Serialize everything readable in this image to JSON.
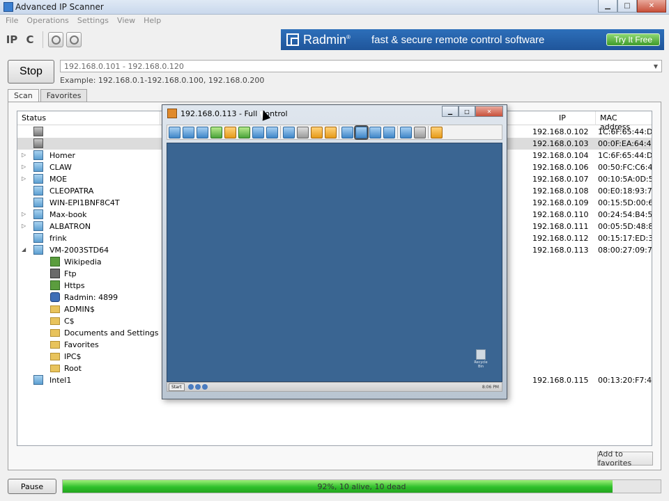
{
  "window": {
    "title": "Advanced IP Scanner",
    "controls": [
      "minimize-icon",
      "maximize-icon",
      "close-icon"
    ]
  },
  "menu": [
    "File",
    "Operations",
    "Settings",
    "View",
    "Help"
  ],
  "toolbar": {
    "ip_label": "IP",
    "c_label": "C",
    "icons": [
      "power-icon",
      "power-icon"
    ]
  },
  "ad": {
    "brand": "Radmin",
    "registered": "®",
    "slogan": "fast & secure remote control software",
    "cta": "Try It Free",
    "color": "#2a66b0"
  },
  "scan": {
    "stop_label": "Stop",
    "range_value": "192.168.0.101 - 192.168.0.120",
    "example": "Example: 192.168.0.1-192.168.0.100, 192.168.0.200"
  },
  "tabs": [
    "Scan",
    "Favorites"
  ],
  "columns": {
    "status": "Status",
    "ip": "IP",
    "mac": "MAC address"
  },
  "rows": [
    {
      "name": "",
      "ip": "192.168.0.102",
      "mac": "1C:6F:65:44:D...",
      "icon": "computer-icon",
      "expander": "",
      "selected": false
    },
    {
      "name": "",
      "ip": "192.168.0.103",
      "mac": "00:0F:EA:64:4...",
      "icon": "computer-icon",
      "expander": "",
      "selected": true
    },
    {
      "name": "Homer",
      "ip": "192.168.0.104",
      "mac": "1C:6F:65:44:D...",
      "icon": "computer-icon",
      "expander": "▷",
      "selected": false
    },
    {
      "name": "CLAW",
      "ip": "192.168.0.106",
      "mac": "00:50:FC:C6:4...",
      "icon": "computer-icon",
      "expander": "▷",
      "selected": false
    },
    {
      "name": "MOE",
      "ip": "192.168.0.107",
      "mac": "00:10:5A:0D:5...",
      "icon": "computer-icon",
      "expander": "▷",
      "selected": false
    },
    {
      "name": "CLEOPATRA",
      "ip": "192.168.0.108",
      "mac": "00:E0:18:93:7...",
      "icon": "computer-icon",
      "expander": "",
      "selected": false
    },
    {
      "name": "WIN-EPI1BNF8C4T",
      "ip": "192.168.0.109",
      "mac": "00:15:5D:00:6...",
      "icon": "computer-icon",
      "expander": "",
      "selected": false
    },
    {
      "name": "Max-book",
      "ip": "192.168.0.110",
      "mac": "00:24:54:B4:5...",
      "icon": "computer-icon",
      "expander": "▷",
      "selected": false
    },
    {
      "name": "ALBATRON",
      "ip": "192.168.0.111",
      "mac": "00:05:5D:48:8...",
      "icon": "computer-icon",
      "expander": "▷",
      "selected": false
    },
    {
      "name": "frink",
      "ip": "192.168.0.112",
      "mac": "00:15:17:ED:3...",
      "icon": "computer-icon",
      "expander": "",
      "selected": false
    },
    {
      "name": "VM-2003STD64",
      "ip": "192.168.0.113",
      "mac": "08:00:27:09:7...",
      "icon": "computer-icon",
      "expander": "◢",
      "selected": false
    },
    {
      "name": "Wikipedia",
      "ip": "",
      "mac": "",
      "icon": "http-service-icon",
      "expander": "",
      "child": true
    },
    {
      "name": "Ftp",
      "ip": "",
      "mac": "",
      "icon": "ftp-icon",
      "expander": "",
      "child": true
    },
    {
      "name": "Https",
      "ip": "",
      "mac": "",
      "icon": "https-service-icon",
      "expander": "",
      "child": true
    },
    {
      "name": "Radmin: 4899",
      "ip": "",
      "mac": "",
      "icon": "radmin-icon",
      "expander": "",
      "child": true
    },
    {
      "name": "ADMIN$",
      "ip": "",
      "mac": "",
      "icon": "folder-icon",
      "expander": "",
      "child": true
    },
    {
      "name": "C$",
      "ip": "",
      "mac": "",
      "icon": "folder-icon",
      "expander": "",
      "child": true
    },
    {
      "name": "Documents and Settings",
      "ip": "",
      "mac": "",
      "icon": "folder-icon",
      "expander": "",
      "child": true
    },
    {
      "name": "Favorites",
      "ip": "",
      "mac": "",
      "icon": "folder-icon",
      "expander": "",
      "child": true
    },
    {
      "name": "IPC$",
      "ip": "",
      "mac": "",
      "icon": "folder-icon",
      "expander": "",
      "child": true
    },
    {
      "name": "Root",
      "ip": "",
      "mac": "",
      "icon": "folder-icon",
      "expander": "",
      "child": true
    },
    {
      "name": "Intel1",
      "ip": "192.168.0.115",
      "mac": "00:13:20:F7:4...",
      "icon": "computer-icon",
      "expander": "",
      "selected": false
    }
  ],
  "add_favorites_label": "Add to favorites",
  "bottom": {
    "pause_label": "Pause",
    "progress_text": "92%, 10 alive, 10 dead",
    "progress_fraction": 0.92
  },
  "remote": {
    "title": "192.168.0.113 - Full Control",
    "start_label": "Start",
    "clock": "8:06 PM",
    "recycle_label": "Recycle Bin",
    "toolbar_icons": [
      "remote-screen-icon",
      "view-icon",
      "telnet-icon",
      "file-transfer-icon",
      "shutdown-icon",
      "chat-icon",
      "voice-call-icon",
      "text-message-icon",
      "send-file-icon",
      "connect-icon",
      "lock-icon",
      "unlock-icon",
      "windowed-icon",
      "fullscreen-icon",
      "scale-icon",
      "stretch-icon",
      "copy-icon",
      "settings-icon",
      "close-session-icon"
    ]
  }
}
